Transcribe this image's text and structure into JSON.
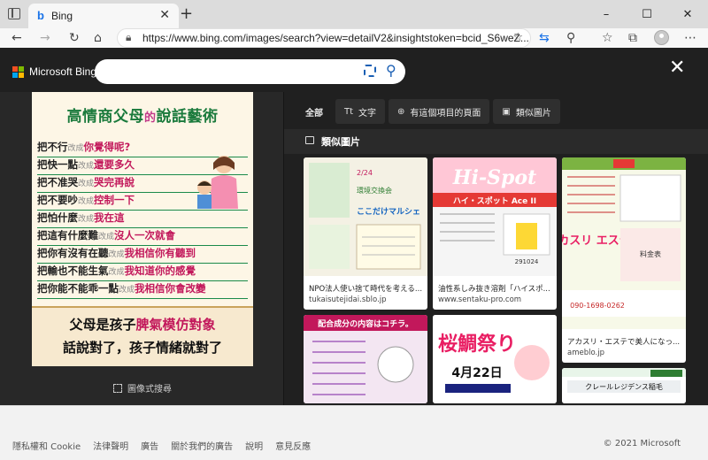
{
  "browser": {
    "tab_title": "Bing",
    "tab_favicon": "b",
    "new_tab_symbol": "+",
    "url": "https://www.bing.com/images/search?view=detailV2&insightstoken=bcid_S6weZ...",
    "window_controls": {
      "minimize": "–",
      "maximize": "☐",
      "close": "✕"
    },
    "nav_icons": [
      "back-icon",
      "forward-icon",
      "refresh-icon",
      "home-icon",
      "lock-icon",
      "favorite-star-icon",
      "translate-icon",
      "extension-icon",
      "favorites-icon",
      "collections-icon",
      "profile-icon",
      "more-icon"
    ]
  },
  "bing": {
    "brand": "Microsoft Bing",
    "brand_colors": [
      "#f25022",
      "#7fba00",
      "#00a4ef",
      "#ffb900"
    ],
    "search_placeholder": "",
    "close_symbol": "✕"
  },
  "preview": {
    "poster": {
      "title_start": "高情商父母",
      "title_mid": "的",
      "title_end": "說話藝術",
      "lines": [
        {
          "a": "把不行",
          "g": "改成",
          "b": "你覺得呢?"
        },
        {
          "a": "把快一點",
          "g": "改成",
          "b": "還要多久"
        },
        {
          "a": "把不准哭",
          "g": "改成",
          "b": "哭完再說"
        },
        {
          "a": "把不要吵",
          "g": "改成",
          "b": "控制一下"
        },
        {
          "a": "把怕什麼",
          "g": "改成",
          "b": "我在這"
        },
        {
          "a": "把這有什麼難",
          "g": "改成",
          "b": "沒人一次就會"
        },
        {
          "a": "把你有沒有在聽",
          "g": "改成",
          "b": "我相信你有聽到"
        },
        {
          "a": "把輸也不能生氣",
          "g": "改成",
          "b": "我知道你的感覺"
        },
        {
          "a": "把你能不能乖一點",
          "g": "改成",
          "b": "我相信你會改變"
        }
      ],
      "bottom_line1_plain": "父母是孩子",
      "bottom_line1_red": "脾氣模仿對象",
      "bottom_line2": "話說對了，孩子情緒就對了"
    },
    "visual_search_label": "圖像式搜尋"
  },
  "tabs": [
    {
      "icon": "",
      "label": "全部",
      "active": true
    },
    {
      "icon": "Tt",
      "label": "文字",
      "active": false
    },
    {
      "icon": "⊕",
      "label": "有這個項目的頁面",
      "active": false
    },
    {
      "icon": "▣",
      "label": "類似圖片",
      "active": false
    }
  ],
  "section_title": "類似圖片",
  "results": [
    {
      "caption": "NPO法人使い捨て時代を考える...",
      "source": "tukaisutejidai.sblo.jp",
      "thumb_title": "ここだけマルシェ",
      "thumb_sub": "環境交換会",
      "thumb_date": "2/24"
    },
    {
      "caption": "油性系しみ抜き溶剤「ハイスポ...",
      "source": "www.sentaku-pro.com",
      "thumb_title": "Hi-Spot",
      "thumb_sub": "ハイ・スポット Ace II",
      "thumb_date": "291024"
    },
    {
      "caption": "アカスリ・エステで美人になっ...",
      "source": "ameblo.jp",
      "thumb_title": "アカスリ エステ",
      "thumb_sub": "料金表",
      "thumb_date": "090-1698-0262"
    },
    {
      "caption": "",
      "source": "",
      "thumb_title": "配合成分の内容はコチラ。",
      "thumb_sub": "",
      "thumb_date": ""
    },
    {
      "caption": "",
      "source": "",
      "thumb_title": "桜鯛祭り",
      "thumb_sub": "",
      "thumb_date": "4月22日"
    },
    {
      "caption": "",
      "source": "",
      "thumb_title": "クレールレジデンス稲毛",
      "thumb_sub": "",
      "thumb_date": ""
    }
  ],
  "footer": {
    "links": [
      "隱私權和 Cookie",
      "法律聲明",
      "廣告",
      "關於我們的廣告",
      "說明",
      "意見反應"
    ],
    "copyright": "© 2021 Microsoft"
  }
}
